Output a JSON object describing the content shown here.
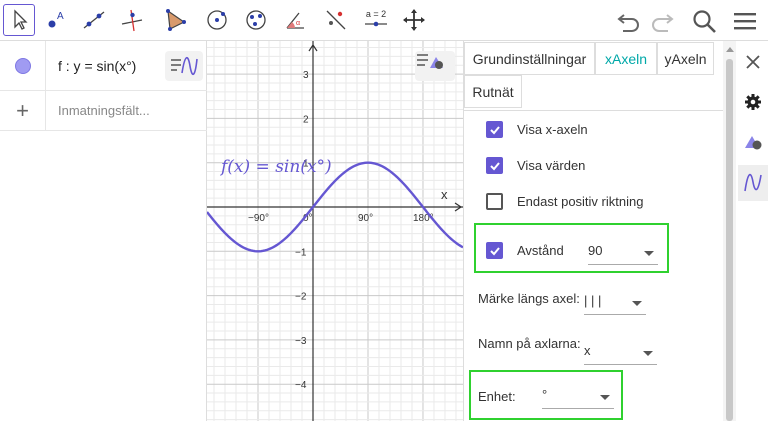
{
  "toolbar": {
    "tools": [
      {
        "name": "move-tool",
        "icon": "cursor-arrow-icon",
        "active": true
      },
      {
        "name": "point-tool",
        "icon": "point-icon"
      },
      {
        "name": "line-tool",
        "icon": "line-icon"
      },
      {
        "name": "perpendicular-tool",
        "icon": "perpendicular-line-icon"
      },
      {
        "name": "polygon-tool",
        "icon": "polygon-icon"
      },
      {
        "name": "circle-center-tool",
        "icon": "circle-center-icon"
      },
      {
        "name": "circle-three-points-tool",
        "icon": "circle-three-points-icon"
      },
      {
        "name": "angle-tool",
        "icon": "angle-icon"
      },
      {
        "name": "reflect-tool",
        "icon": "reflect-icon"
      },
      {
        "name": "slider-tool",
        "icon": "slider-icon",
        "text": "a = 2"
      },
      {
        "name": "move-graphics-tool",
        "icon": "move-arrows-icon"
      }
    ],
    "right": [
      "undo-icon",
      "redo-icon",
      "search-icon",
      "menu-icon"
    ]
  },
  "algebra": {
    "items": [
      {
        "text": "f : y = sin(x°)",
        "color": "#a09bf2"
      }
    ],
    "input_placeholder": "Inmatningsfält..."
  },
  "graphics": {
    "function_label": "f(x) = sin(x°)",
    "x_axis_name": "x",
    "x_ticks": [
      "−90°",
      "0°",
      "90°",
      "180°"
    ],
    "y_ticks": [
      "3",
      "2",
      "1",
      "−1",
      "−2",
      "−3",
      "−4"
    ],
    "curve_color": "#6557d2"
  },
  "settings": {
    "tabs": [
      {
        "label": "Grundinställningar",
        "active": false
      },
      {
        "label": "xAxeln",
        "active": true
      },
      {
        "label": "yAxeln",
        "active": false
      },
      {
        "label": "Rutnät",
        "active": false
      }
    ],
    "options": [
      {
        "label": "Visa x-axeln",
        "checked": true
      },
      {
        "label": "Visa värden",
        "checked": true
      },
      {
        "label": "Endast positiv riktning",
        "checked": false
      }
    ],
    "distance": {
      "label": "Avstånd",
      "checked": true,
      "value": "90"
    },
    "tick_style": {
      "label": "Märke längs axel:",
      "value": "| | |"
    },
    "axis_name": {
      "label": "Namn på axlarna:",
      "value": "x"
    },
    "unit": {
      "label": "Enhet:",
      "value": "°"
    },
    "accent_color": "#6557d2",
    "tab_active_color": "#00a8a8",
    "highlight_color": "#2fd12f"
  },
  "sidestrip": {
    "buttons": [
      "close-icon",
      "gear-icon",
      "graphics-style-icon",
      "algebra-style-icon"
    ]
  }
}
